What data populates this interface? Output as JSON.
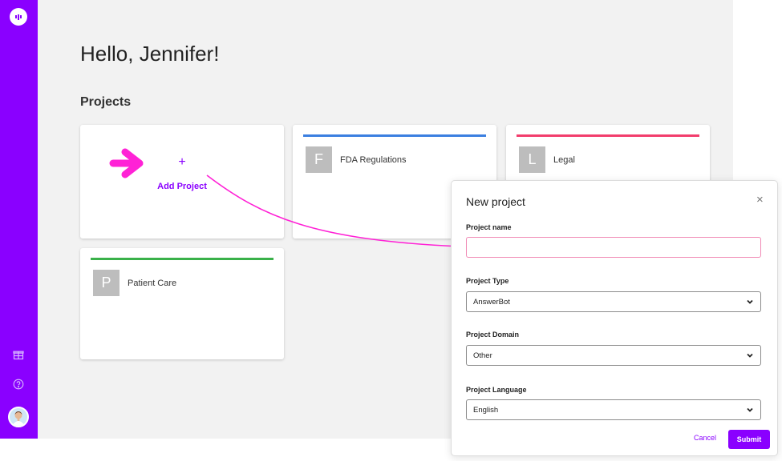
{
  "greeting": "Hello, Jennifer!",
  "projects_heading": "Projects",
  "add_project": {
    "plus": "+",
    "label": "Add Project"
  },
  "projects": [
    {
      "letter": "F",
      "name": "FDA Regulations",
      "color": "#3b7fe0"
    },
    {
      "letter": "L",
      "name": "Legal",
      "color": "#f23d6d"
    },
    {
      "letter": "P",
      "name": "Patient Care",
      "color": "#3ab14a"
    }
  ],
  "sidebar": {
    "icons": [
      "logo-icon",
      "gift-icon",
      "help-icon",
      "user-avatar"
    ],
    "accent": "#8a00ff"
  },
  "modal": {
    "title": "New project",
    "close": "×",
    "fields": {
      "name": {
        "label": "Project name",
        "value": "",
        "placeholder": ""
      },
      "type": {
        "label": "Project Type",
        "value": "AnswerBot"
      },
      "domain": {
        "label": "Project Domain",
        "value": "Other"
      },
      "language": {
        "label": "Project Language",
        "value": "English"
      }
    },
    "cancel": "Cancel",
    "submit": "Submit"
  },
  "annotation": {
    "arrow_color": "#ff22d6"
  }
}
